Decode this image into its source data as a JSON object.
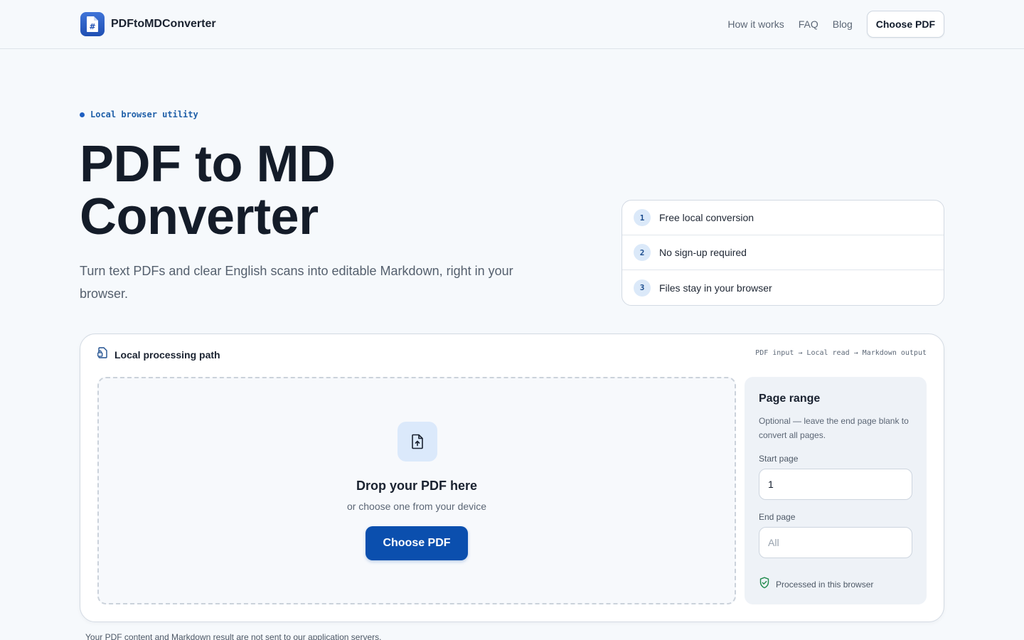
{
  "header": {
    "brand": "PDFtoMDConverter",
    "nav": [
      "How it works",
      "FAQ",
      "Blog"
    ],
    "cta": "Choose PDF"
  },
  "hero": {
    "eyebrow": "Local browser utility",
    "title": "PDF to MD Converter",
    "subtitle": "Turn text PDFs and clear English scans into editable Markdown, right in your browser."
  },
  "features": [
    {
      "num": "1",
      "label": "Free local conversion"
    },
    {
      "num": "2",
      "label": "No sign-up required"
    },
    {
      "num": "3",
      "label": "Files stay in your browser"
    }
  ],
  "card": {
    "title": "Local processing path",
    "path": "PDF input → Local read → Markdown output",
    "drop": {
      "title": "Drop your PDF here",
      "subtitle": "or choose one from your device",
      "button": "Choose PDF"
    },
    "range": {
      "title": "Page range",
      "description": "Optional — leave the end page blank to convert all pages.",
      "start_label": "Start page",
      "start_value": "1",
      "end_label": "End page",
      "end_placeholder": "All",
      "note": "Processed in this browser"
    }
  },
  "footnote": "Your PDF content and Markdown result are not sent to our application servers.",
  "colors": {
    "accent": "#0b4fae",
    "background": "#f6f9fc",
    "safe_icon": "#1f8a4c"
  },
  "icons": {
    "brand": "hash-document-icon",
    "card_head": "file-lock-icon",
    "drop": "file-upload-icon",
    "safe": "shield-check-icon"
  }
}
